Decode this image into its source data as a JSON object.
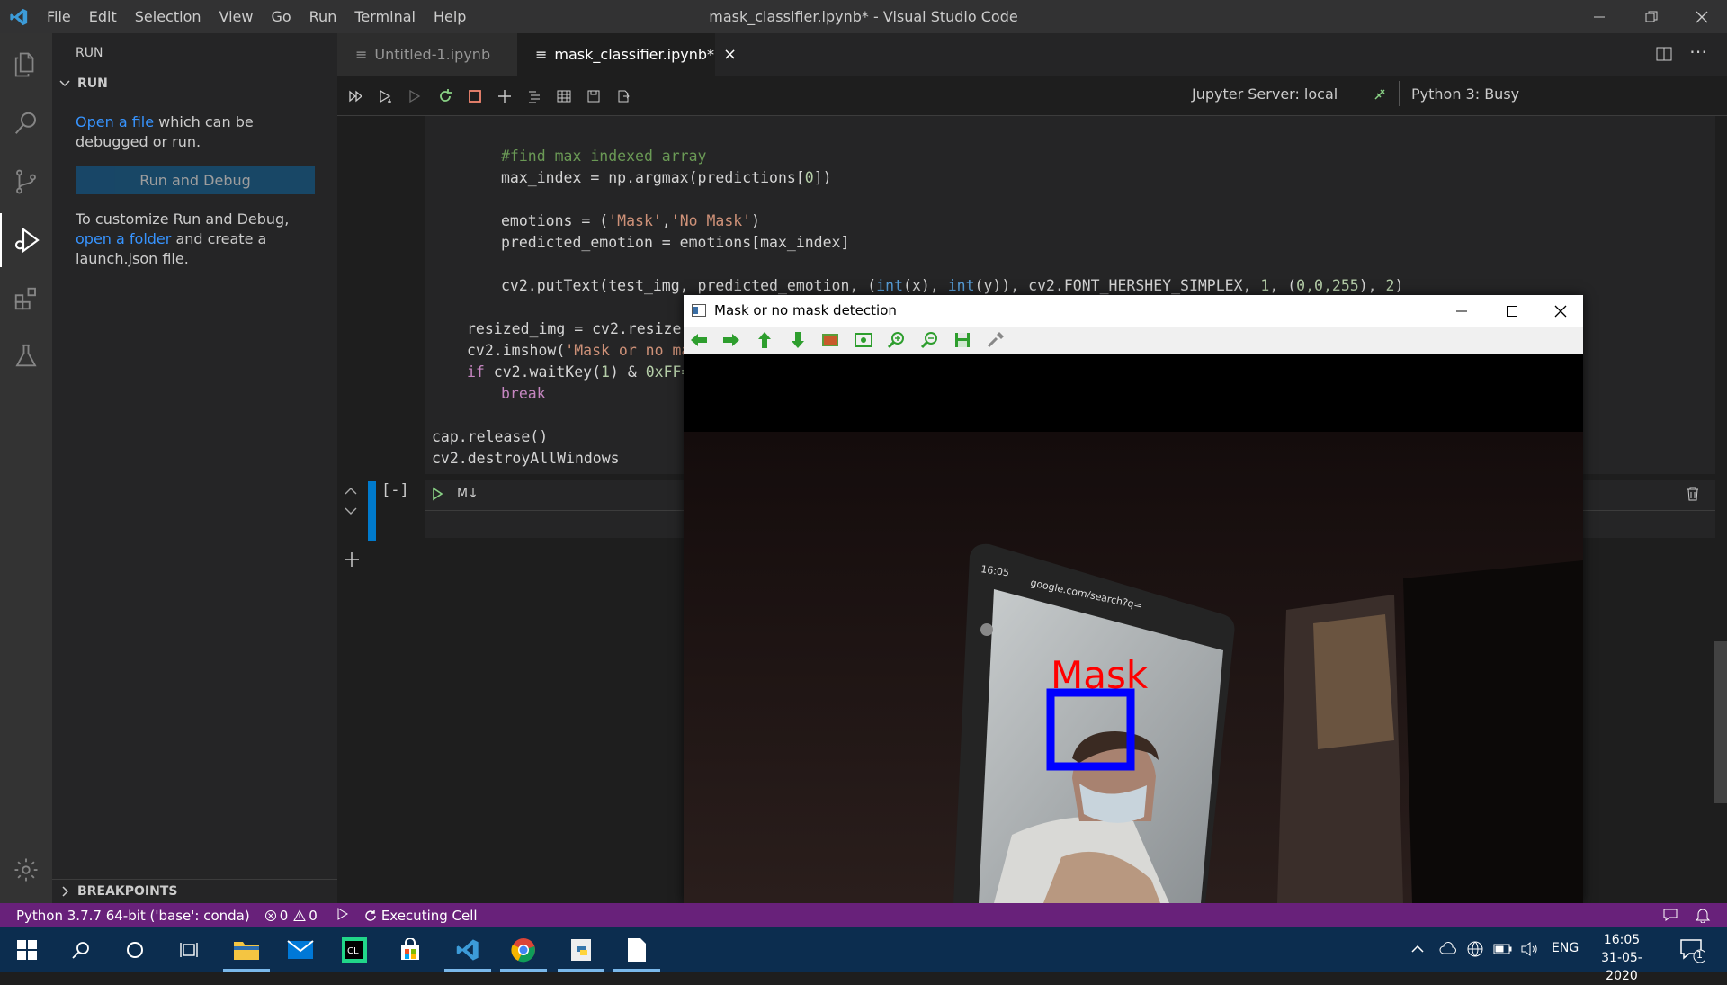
{
  "window": {
    "title": "mask_classifier.ipynb* - Visual Studio Code"
  },
  "menu": [
    "File",
    "Edit",
    "Selection",
    "View",
    "Go",
    "Run",
    "Terminal",
    "Help"
  ],
  "sidebar": {
    "header": "RUN",
    "section": "RUN",
    "open_link": "Open a file",
    "open_rest": " which can be debugged or run.",
    "run_button": "Run and Debug",
    "customize_pre": "To customize Run and Debug, ",
    "customize_link": "open a folder",
    "customize_post": " and create a launch.json file.",
    "breakpoints": "BREAKPOINTS"
  },
  "tabs": [
    {
      "label": "Untitled-1.ipynb",
      "active": false
    },
    {
      "label": "mask_classifier.ipynb*",
      "active": true
    }
  ],
  "toolbar": {
    "server": "Jupyter Server: local",
    "kernel": "Python 3: Busy"
  },
  "code": {
    "l1": "#find max indexed array",
    "l2a": "max_index = np.argmax(predictions[",
    "l2n": "0",
    "l2b": "])",
    "l3a": "emotions = (",
    "l3s1": "'Mask'",
    "l3c": ",",
    "l3s2": "'No Mask'",
    "l3b": ")",
    "l4": "predicted_emotion = emotions[max_index]",
    "l5a": "cv2.putText(test_img, predicted_emotion, (",
    "l5k1": "int",
    "l5x": "(x), ",
    "l5k2": "int",
    "l5y": "(y)), cv2.FONT_HERSHEY_SIMPLEX, ",
    "l5n1": "1",
    "l5m": ", (",
    "l5n2": "0,0,255",
    "l5e": "), ",
    "l5n3": "2",
    "l5f": ")",
    "l6": "resized_img = cv2.resize(",
    "l7a": "cv2.imshow(",
    "l7s": "'Mask or no ma",
    "l8k": "if",
    "l8a": " cv2.waitKey(",
    "l8n": "1",
    "l8b": ") & ",
    "l8h": "0xFF=",
    "l9": "break",
    "l10": "cap.release()",
    "l11": "cv2.destroyAllWindows"
  },
  "cell": {
    "exec": "[-]",
    "md": "M↓"
  },
  "cv_window": {
    "title": "Mask or no mask detection",
    "label": "Mask"
  },
  "phone": {
    "time": "16:05",
    "url": "google.com/search?q="
  },
  "status": {
    "python": "Python 3.7.7 64-bit ('base': conda)",
    "errors": "0",
    "warnings": "0",
    "executing": "Executing Cell"
  },
  "taskbar": {
    "lang": "ENG",
    "time": "16:05",
    "date": "31-05-2020",
    "notif": "1"
  }
}
